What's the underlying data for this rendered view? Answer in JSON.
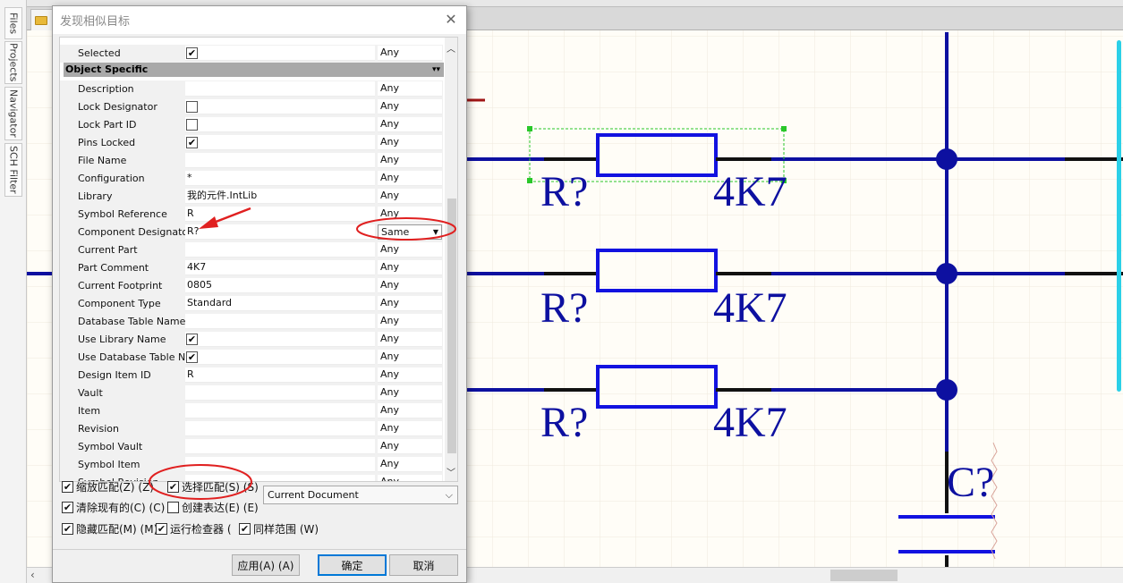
{
  "side_tabs": [
    "Files",
    "Projects",
    "Navigator",
    "SCH Filter"
  ],
  "schematic": {
    "designators": [
      "R?",
      "R?",
      "R?",
      "C?"
    ],
    "values": [
      "4K7",
      "4K7",
      "4K7"
    ]
  },
  "dialog": {
    "title": "发现相似目标",
    "close_symbol": "✕",
    "selected_row": {
      "label": "Selected",
      "checked": true,
      "match": "Any"
    },
    "section_header": "Object Specific",
    "rows": [
      {
        "label": "Description",
        "value": "",
        "match": "Any"
      },
      {
        "label": "Lock Designator",
        "value": "",
        "checkbox": true,
        "checked": false,
        "match": "Any"
      },
      {
        "label": "Lock Part ID",
        "value": "",
        "checkbox": true,
        "checked": false,
        "match": "Any"
      },
      {
        "label": "Pins Locked",
        "value": "",
        "checkbox": true,
        "checked": true,
        "match": "Any"
      },
      {
        "label": "File Name",
        "value": "",
        "match": "Any"
      },
      {
        "label": "Configuration",
        "value": "*",
        "match": "Any"
      },
      {
        "label": "Library",
        "value": "我的元件.IntLib",
        "match": "Any"
      },
      {
        "label": "Symbol Reference",
        "value": "R",
        "match": "Any"
      },
      {
        "label": "Component Designator",
        "value": "R?",
        "match": "Same"
      },
      {
        "label": "Current Part",
        "value": "",
        "match": "Any"
      },
      {
        "label": "Part Comment",
        "value": "4K7",
        "match": "Any"
      },
      {
        "label": "Current Footprint",
        "value": "0805",
        "match": "Any"
      },
      {
        "label": "Component Type",
        "value": "Standard",
        "match": "Any"
      },
      {
        "label": "Database Table Name",
        "value": "",
        "match": "Any"
      },
      {
        "label": "Use Library Name",
        "value": "",
        "checkbox": true,
        "checked": true,
        "match": "Any"
      },
      {
        "label": "Use Database Table Name",
        "value": "",
        "checkbox": true,
        "checked": true,
        "match": "Any"
      },
      {
        "label": "Design Item ID",
        "value": "R",
        "match": "Any"
      },
      {
        "label": "Vault",
        "value": "",
        "match": "Any"
      },
      {
        "label": "Item",
        "value": "",
        "match": "Any"
      },
      {
        "label": "Revision",
        "value": "",
        "match": "Any"
      },
      {
        "label": "Symbol Vault",
        "value": "",
        "match": "Any"
      },
      {
        "label": "Symbol Item",
        "value": "",
        "match": "Any"
      },
      {
        "label": "Symbol Revision",
        "value": "",
        "match": "Any"
      }
    ],
    "options": {
      "zoom_match": "缩放匹配(Z) (Z)",
      "select_match": "选择匹配(S) (S)",
      "clear_existing": "清除现有的(C) (C)",
      "create_expression": "创建表达(E) (E)",
      "mask_match": "隐藏匹配(M) (M)",
      "run_inspector": "运行检查器 (",
      "same_scope": "同样范围 (W)"
    },
    "scope_select": "Current Document",
    "buttons": {
      "apply": "应用(A) (A)",
      "ok": "确定",
      "cancel": "取消"
    }
  }
}
